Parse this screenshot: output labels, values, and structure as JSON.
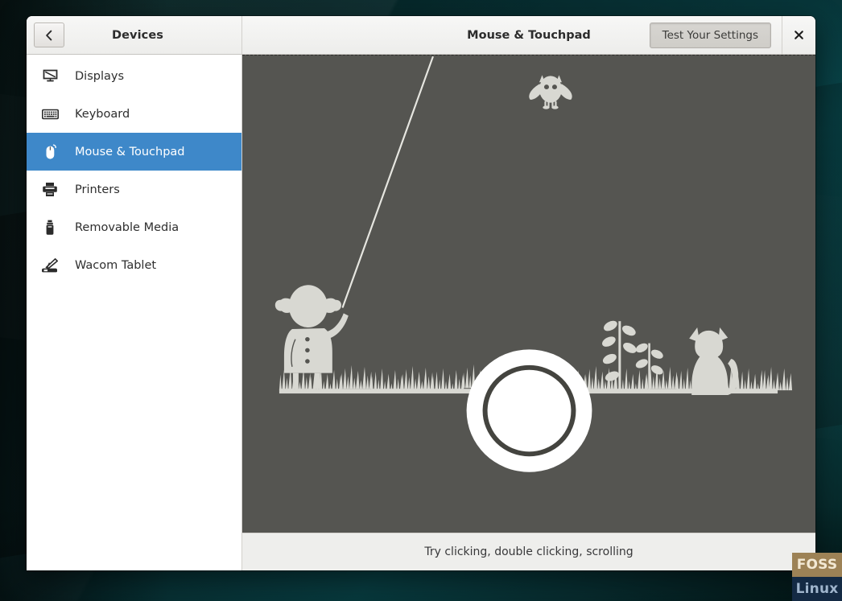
{
  "window": {
    "panel_title": "Devices",
    "page_title": "Mouse & Touchpad",
    "back_icon": "chevron-left-icon",
    "close_icon": "close-icon",
    "test_button_label": "Test Your Settings"
  },
  "sidebar": {
    "items": [
      {
        "label": "Displays",
        "icon": "display-icon",
        "selected": false
      },
      {
        "label": "Keyboard",
        "icon": "keyboard-icon",
        "selected": false
      },
      {
        "label": "Mouse & Touchpad",
        "icon": "mouse-icon",
        "selected": true
      },
      {
        "label": "Printers",
        "icon": "printer-icon",
        "selected": false
      },
      {
        "label": "Removable Media",
        "icon": "usb-drive-icon",
        "selected": false
      },
      {
        "label": "Wacom Tablet",
        "icon": "wacom-tablet-icon",
        "selected": false
      }
    ]
  },
  "test_area": {
    "status_text": "Try clicking, double clicking, scrolling",
    "scene_elements": [
      "kite-string",
      "owl-bird",
      "girl-with-pigtails",
      "grass-field",
      "plants-with-leaves",
      "sitting-cat",
      "click-indicator-circle"
    ]
  },
  "watermark": {
    "line1": "FOSS",
    "line2": "Linux"
  },
  "colors": {
    "accent_blue": "#3e88c9",
    "test_area_gray": "#555551",
    "scene_figure": "#d8d8d2",
    "headerbar": "#ededeb",
    "statusbar": "#eeeeec",
    "desktop_teal": "#0a4247",
    "watermark_gold": "#9d8256",
    "watermark_navy": "#142a44"
  }
}
